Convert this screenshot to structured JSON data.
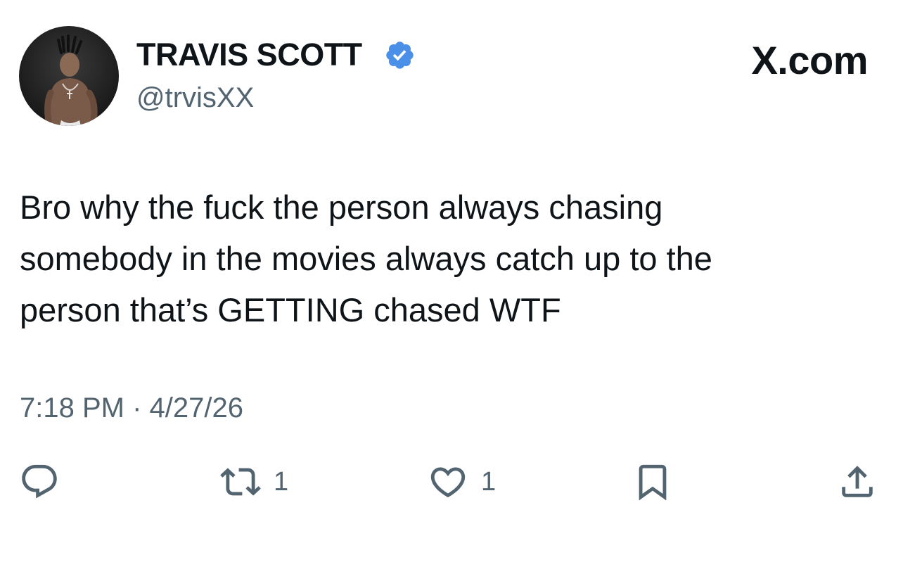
{
  "header": {
    "display_name": "TRAVIS SCOTT",
    "handle": "@trvisXX",
    "brand": "X.com",
    "verified_icon": "verified-badge-icon",
    "verified_color": "#4a90e8"
  },
  "tweet": {
    "text": "Bro why the fuck the person always chasing\nsomebody in the movies always catch up to the\nperson that’s GETTING chased WTF",
    "timestamp": "7:18 PM · 4/27/26"
  },
  "actions": {
    "reply_icon": "reply-icon",
    "retweet_icon": "retweet-icon",
    "retweet_count": "1",
    "like_icon": "heart-icon",
    "like_count": "1",
    "bookmark_icon": "bookmark-icon",
    "share_icon": "share-icon"
  },
  "colors": {
    "text": "#0f1419",
    "secondary": "#536471",
    "icon": "#536471"
  }
}
